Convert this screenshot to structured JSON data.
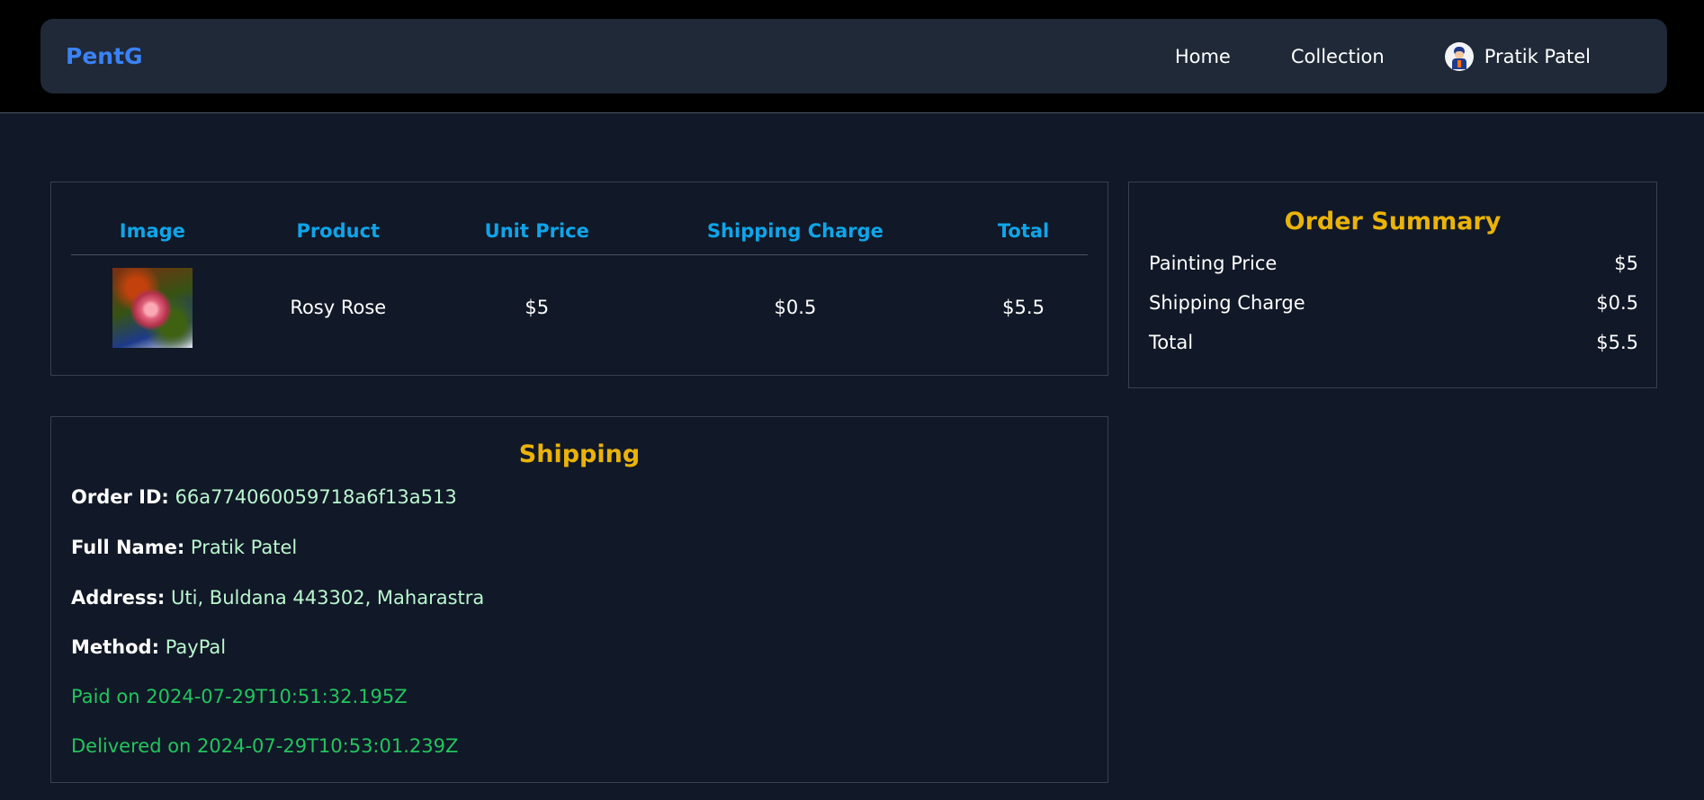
{
  "header": {
    "brand": "PentG",
    "nav": [
      {
        "label": "Home"
      },
      {
        "label": "Collection"
      }
    ],
    "user": {
      "name": "Pratik Patel",
      "avatar_icon": "user-avatar-icon"
    }
  },
  "cart": {
    "columns": [
      "Image",
      "Product",
      "Unit Price",
      "Shipping Charge",
      "Total"
    ],
    "rows": [
      {
        "image_icon": "rose-painting-thumbnail",
        "product": "Rosy Rose",
        "unit_price": "$5",
        "shipping_charge": "$0.5",
        "total": "$5.5"
      }
    ]
  },
  "summary": {
    "title": "Order Summary",
    "rows": [
      {
        "label": "Painting Price",
        "value": "$5"
      },
      {
        "label": "Shipping Charge",
        "value": "$0.5"
      },
      {
        "label": "Total",
        "value": "$5.5"
      }
    ]
  },
  "shipping": {
    "title": "Shipping",
    "order_id_label": "Order ID:",
    "order_id": "66a774060059718a6f13a513",
    "full_name_label": "Full Name:",
    "full_name": "Pratik Patel",
    "address_label": "Address:",
    "address": "Uti, Buldana 443302, Maharastra",
    "method_label": "Method:",
    "method": "PayPal",
    "paid": "Paid on 2024-07-29T10:51:32.195Z",
    "delivered": "Delivered on 2024-07-29T10:53:01.239Z"
  },
  "colors": {
    "brand": "#3b82f6",
    "table_header": "#0ea5e9",
    "section_title": "#eab308",
    "value_text": "#bbf7d0",
    "status": "#22c55e",
    "background": "#111827",
    "navbar": "#1f2937"
  }
}
